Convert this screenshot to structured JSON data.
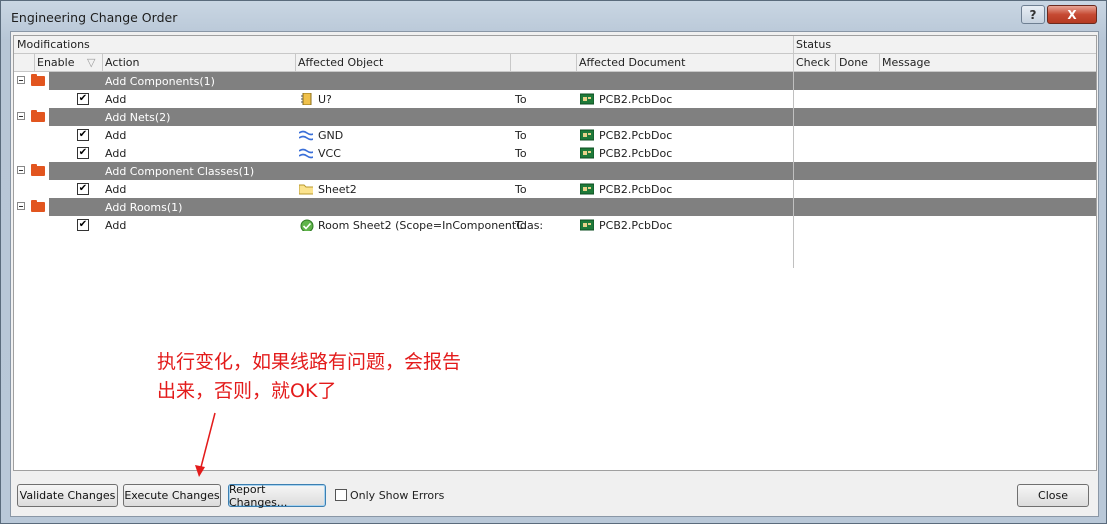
{
  "window": {
    "title": "Engineering Change Order",
    "help_label": "?",
    "close_label": "X"
  },
  "headers": {
    "modifications": "Modifications",
    "status": "Status",
    "enable": "Enable",
    "action": "Action",
    "affected_object": "Affected Object",
    "affected_document": "Affected Document",
    "check": "Check",
    "done": "Done",
    "message": "Message"
  },
  "groups": [
    {
      "label": "Add Components(1)"
    },
    {
      "label": "Add Nets(2)"
    },
    {
      "label": "Add Component Classes(1)"
    },
    {
      "label": "Add Rooms(1)"
    }
  ],
  "rows": [
    {
      "checked": "✔",
      "action": "Add",
      "object": "U?",
      "to": "To",
      "document": "PCB2.PcbDoc",
      "icon": "component-icon"
    },
    {
      "checked": "✔",
      "action": "Add",
      "object": "GND",
      "to": "To",
      "document": "PCB2.PcbDoc",
      "icon": "net-icon"
    },
    {
      "checked": "✔",
      "action": "Add",
      "object": "VCC",
      "to": "To",
      "document": "PCB2.PcbDoc",
      "icon": "net-icon"
    },
    {
      "checked": "✔",
      "action": "Add",
      "object": "Sheet2",
      "to": "To",
      "document": "PCB2.PcbDoc",
      "icon": "folder-icon"
    },
    {
      "checked": "✔",
      "action": "Add",
      "object": "Room Sheet2 (Scope=InComponentClas:",
      "to": "To",
      "document": "PCB2.PcbDoc",
      "icon": "room-icon"
    }
  ],
  "annotation": {
    "line1": "执行变化，如果线路有问题，会报告",
    "line2": "出来，否则，就OK了",
    "color": "#e31b1b"
  },
  "buttons": {
    "validate": "Validate Changes",
    "execute": "Execute Changes",
    "report": "Report Changes...",
    "only_errors": "Only Show Errors",
    "close": "Close"
  }
}
